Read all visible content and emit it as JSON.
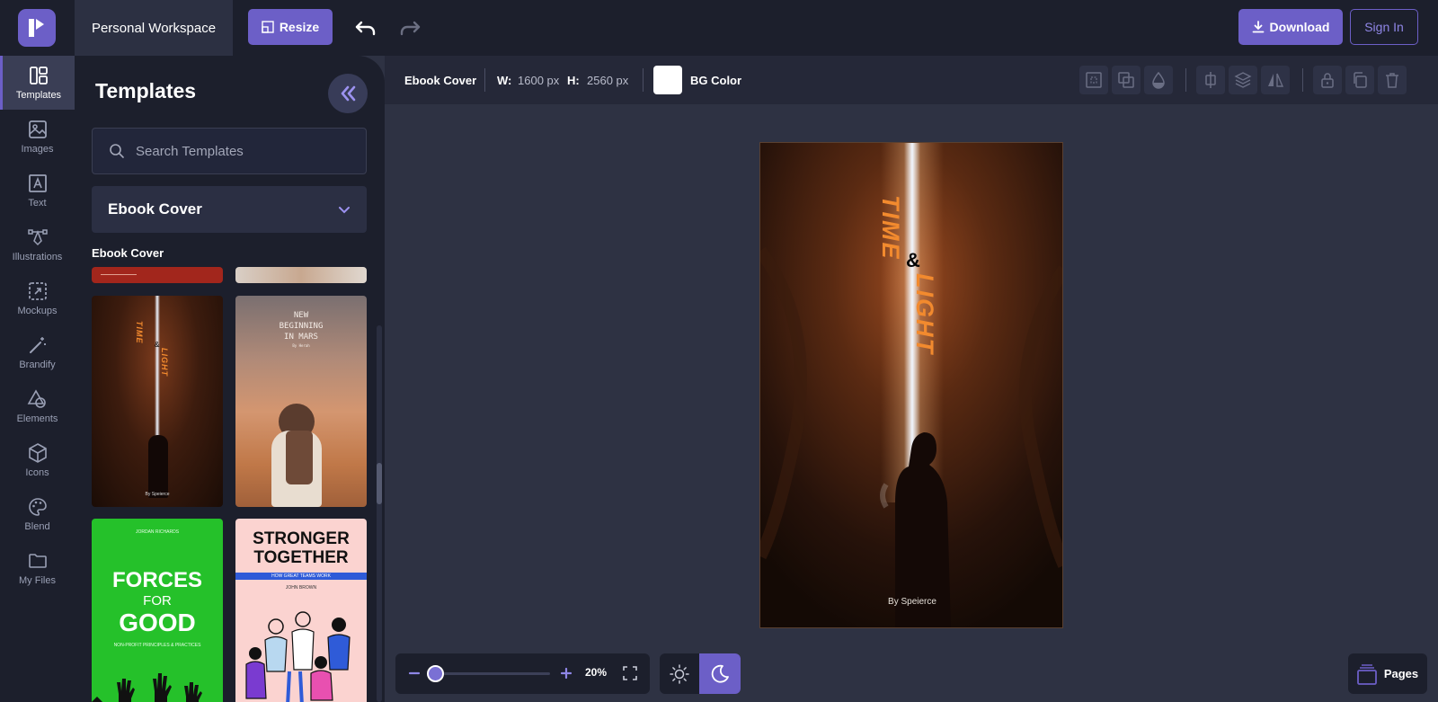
{
  "header": {
    "workspace": "Personal Workspace",
    "resize_label": "Resize",
    "download_label": "Download",
    "signin_label": "Sign In"
  },
  "sidebar": {
    "items": [
      {
        "label": "Templates",
        "icon": "templates-icon",
        "active": true
      },
      {
        "label": "Images",
        "icon": "image-icon"
      },
      {
        "label": "Text",
        "icon": "text-icon"
      },
      {
        "label": "Illustrations",
        "icon": "pen-tool-icon"
      },
      {
        "label": "Mockups",
        "icon": "mockup-icon"
      },
      {
        "label": "Brandify",
        "icon": "magic-wand-icon"
      },
      {
        "label": "Elements",
        "icon": "shapes-icon"
      },
      {
        "label": "Icons",
        "icon": "cube-icon"
      },
      {
        "label": "Blend",
        "icon": "palette-icon"
      },
      {
        "label": "My Files",
        "icon": "folder-icon"
      }
    ]
  },
  "panel": {
    "title": "Templates",
    "search_placeholder": "Search Templates",
    "category": "Ebook Cover",
    "section_label": "Ebook Cover",
    "thumbs": [
      {
        "title": "TIME",
        "title2": "LIGHT",
        "amp": "&",
        "author": "By Speierce"
      },
      {
        "title": "NEW BEGINNING IN MARS",
        "line1": "NEW",
        "line2": "BEGINNING",
        "line3": "IN MARS",
        "author": "By Herah"
      },
      {
        "author": "JORDAN RICHARDS",
        "line1": "FORCES",
        "line2": "FOR",
        "line3": "GOOD",
        "subtitle": "NON-PROFIT PRINCIPLES & PRACTICES"
      },
      {
        "line1": "STRONGER",
        "line2": "TOGETHER",
        "subtitle": "HOW GREAT TEAMS WORK",
        "author": "JOHN BROWN"
      }
    ]
  },
  "props": {
    "doc_name": "Ebook Cover",
    "w_label": "W:",
    "w_value": "1600 px",
    "h_label": "H:",
    "h_value": "2560 px",
    "bg_label": "BG Color",
    "bg_color": "#ffffff"
  },
  "canvas": {
    "title1": "TIME",
    "amp": "&",
    "title2": "LIGHT",
    "author": "By Speierce"
  },
  "zoom": {
    "value": "20%",
    "level": 0.2
  },
  "pages_label": "Pages",
  "colors": {
    "accent": "#6c5fc7",
    "title_orange": "#f28a2e"
  }
}
